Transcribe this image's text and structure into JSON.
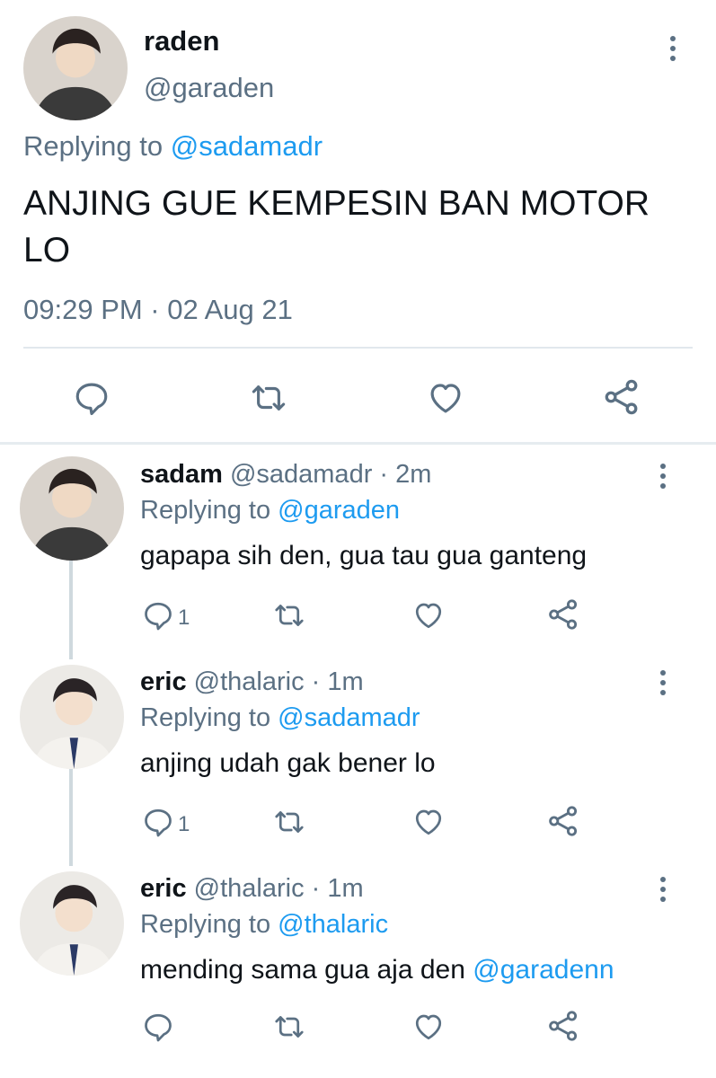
{
  "main_tweet": {
    "name": "raden",
    "handle": "@garaden",
    "replying_prefix": "Replying to",
    "replying_to": "@sadamadr",
    "text": "ANJING GUE KEMPESIN BAN MOTOR LO",
    "timestamp": "09:29 PM · 02 Aug 21",
    "actions": [
      "reply-icon",
      "retweet-icon",
      "like-icon",
      "share-icon"
    ]
  },
  "replies": [
    {
      "name": "sadam",
      "handle": "@sadamadr",
      "time": "· 2m",
      "replying_prefix": "Replying to",
      "replying_to": "@garaden",
      "text": "gapapa sih den, gua tau gua ganteng",
      "mention": "",
      "reply_count": "1"
    },
    {
      "name": "eric",
      "handle": "@thalaric",
      "time": "· 1m",
      "replying_prefix": "Replying to",
      "replying_to": "@sadamadr",
      "text": "anjing udah gak bener lo",
      "mention": "",
      "reply_count": "1"
    },
    {
      "name": "eric",
      "handle": "@thalaric",
      "time": "· 1m",
      "replying_prefix": "Replying to",
      "replying_to": "@thalaric",
      "text": "mending sama gua aja den ",
      "mention": "@garadenn",
      "reply_count": ""
    }
  ],
  "colors": {
    "accent": "#1d9bf0",
    "muted": "#5b7083",
    "text": "#0f1419",
    "divider": "#e1e8ed",
    "thread_line": "#cfd9de"
  }
}
